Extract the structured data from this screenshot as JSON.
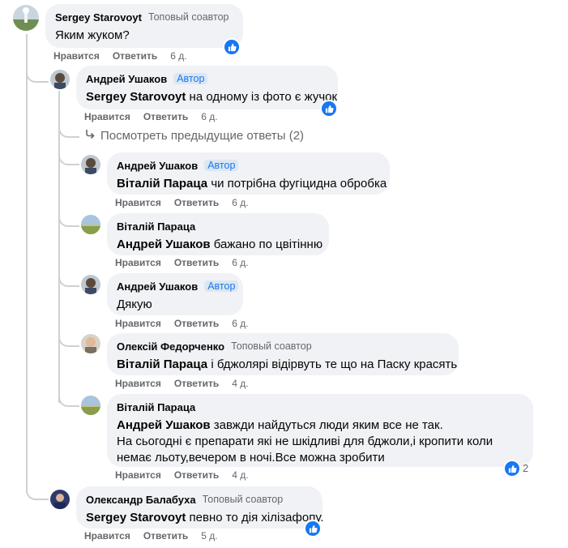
{
  "comments": [
    {
      "author": "Sergey Starovoyt",
      "badge": "Топовый соавтор",
      "mention": "",
      "text": "Яким жуком?",
      "like": "Нравится",
      "reply": "Ответить",
      "time": "6 д."
    },
    {
      "author": "Андрей Ушаков",
      "badge": "Автор",
      "mention": "Sergey Starovoyt",
      "text": " на одному із фото є жучок",
      "like": "Нравится",
      "reply": "Ответить",
      "time": "6 д."
    },
    {
      "author": "Андрей Ушаков",
      "badge": "Автор",
      "mention": "Віталій Параца",
      "text": " чи потрібна фугіцидна обробка",
      "like": "Нравится",
      "reply": "Ответить",
      "time": "6 д."
    },
    {
      "author": "Віталій Параца",
      "badge": "",
      "mention": "Андрей Ушаков",
      "text": " бажано по цвітінню",
      "like": "Нравится",
      "reply": "Ответить",
      "time": "6 д."
    },
    {
      "author": "Андрей Ушаков",
      "badge": "Автор",
      "mention": "",
      "text": "Дякую",
      "like": "Нравится",
      "reply": "Ответить",
      "time": "6 д."
    },
    {
      "author": "Олексій Федорченко",
      "badge": "Топовый соавтор",
      "mention": "Віталій Параца",
      "text": " і бджолярі відірвуть те що на Паску красять",
      "like": "Нравится",
      "reply": "Ответить",
      "time": "4 д."
    },
    {
      "author": "Віталій Параца",
      "badge": "",
      "mention": "Андрей Ушаков",
      "text": " завжди найдуться люди яким все не так.",
      "text_line2": "На сьогодні є препарати які не шкідливі для бджоли,і кропити коли",
      "text_line3": "немає льоту,вечером в ночі.Все можна зробити",
      "like": "Нравится",
      "reply": "Ответить",
      "time": "4 д.",
      "reactions": "2"
    },
    {
      "author": "Олександр Балабуха",
      "badge": "Топовый соавтор",
      "mention": "Sergey Starovoyt",
      "text": " певно то дія хілізафопу.",
      "like": "Нравится",
      "reply": "Ответить",
      "time": "5 д."
    }
  ],
  "view_previous": "Посмотреть предыдущие ответы (2)",
  "colors": {
    "bubble": "#f0f2f5",
    "accent": "#1877f2",
    "meta": "#65676b"
  },
  "icons": {
    "like": "thumbs-up-icon",
    "reply_arrow": "reply-arrow-icon"
  }
}
